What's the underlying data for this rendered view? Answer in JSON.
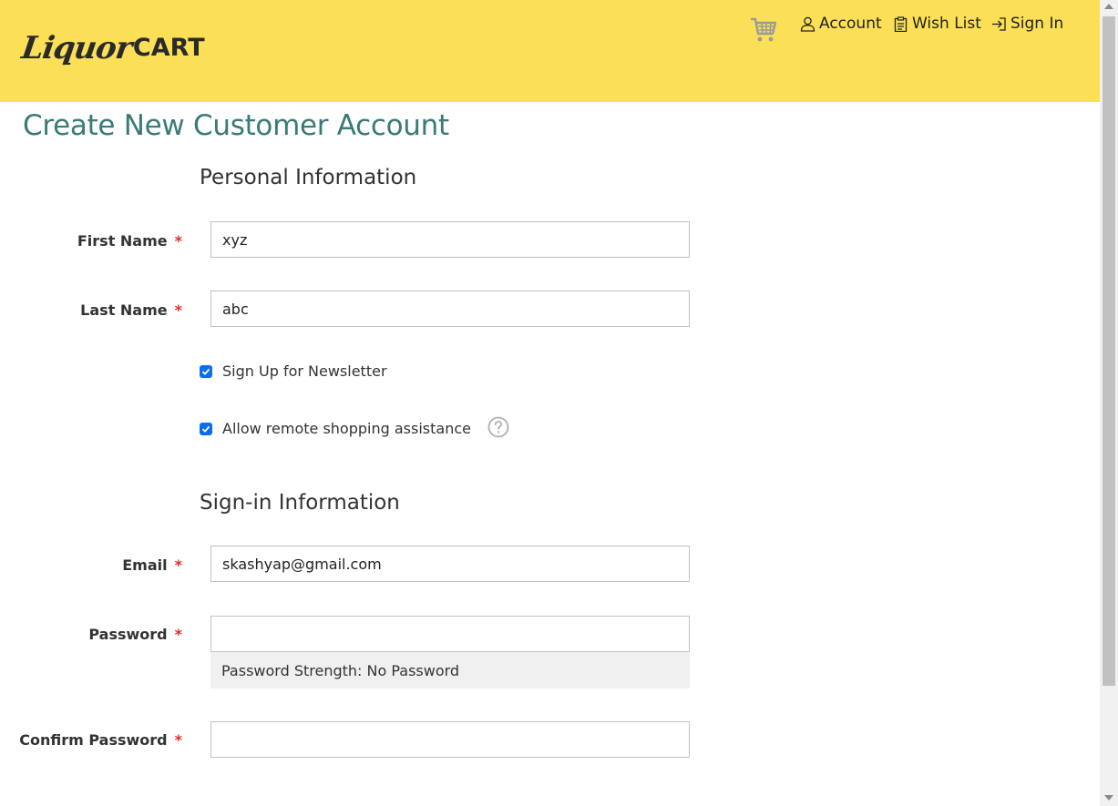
{
  "header": {
    "logo_script": "Liquor",
    "logo_cart": "CART",
    "nav": {
      "account": "Account",
      "wishlist": "Wish List",
      "signin": "Sign In"
    }
  },
  "page": {
    "title": "Create New Customer Account"
  },
  "personal": {
    "section_title": "Personal Information",
    "first_name": {
      "label": "First Name",
      "value": "xyz"
    },
    "last_name": {
      "label": "Last Name",
      "value": "abc"
    },
    "newsletter": {
      "label": "Sign Up for Newsletter",
      "checked": true
    },
    "remote_assist": {
      "label": "Allow remote shopping assistance",
      "checked": true
    }
  },
  "signin": {
    "section_title": "Sign-in Information",
    "email": {
      "label": "Email",
      "value": "skashyap@gmail.com"
    },
    "password": {
      "label": "Password",
      "value": ""
    },
    "password_strength": "Password Strength: No Password",
    "confirm_password": {
      "label": "Confirm Password",
      "value": ""
    }
  },
  "required_marker": "*",
  "colors": {
    "header_bg": "#fbe057",
    "title_teal": "#3a7a78",
    "required_red": "#e02b27",
    "checkbox_blue": "#0b6ef0"
  }
}
